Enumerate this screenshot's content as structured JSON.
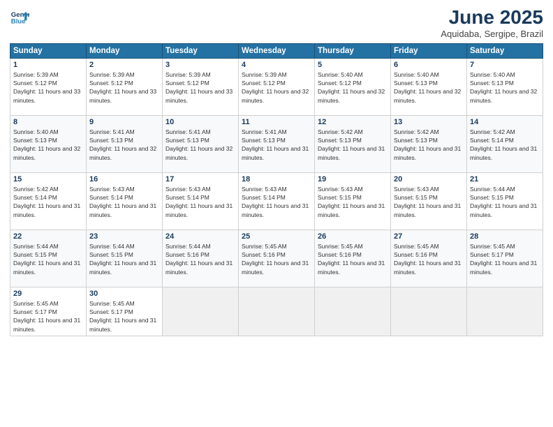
{
  "header": {
    "logo_line1": "General",
    "logo_line2": "Blue",
    "month": "June 2025",
    "location": "Aquidaba, Sergipe, Brazil"
  },
  "weekdays": [
    "Sunday",
    "Monday",
    "Tuesday",
    "Wednesday",
    "Thursday",
    "Friday",
    "Saturday"
  ],
  "weeks": [
    [
      {
        "day": "1",
        "sunrise": "5:39 AM",
        "sunset": "5:12 PM",
        "daylight": "11 hours and 33 minutes."
      },
      {
        "day": "2",
        "sunrise": "5:39 AM",
        "sunset": "5:12 PM",
        "daylight": "11 hours and 33 minutes."
      },
      {
        "day": "3",
        "sunrise": "5:39 AM",
        "sunset": "5:12 PM",
        "daylight": "11 hours and 33 minutes."
      },
      {
        "day": "4",
        "sunrise": "5:39 AM",
        "sunset": "5:12 PM",
        "daylight": "11 hours and 32 minutes."
      },
      {
        "day": "5",
        "sunrise": "5:40 AM",
        "sunset": "5:12 PM",
        "daylight": "11 hours and 32 minutes."
      },
      {
        "day": "6",
        "sunrise": "5:40 AM",
        "sunset": "5:13 PM",
        "daylight": "11 hours and 32 minutes."
      },
      {
        "day": "7",
        "sunrise": "5:40 AM",
        "sunset": "5:13 PM",
        "daylight": "11 hours and 32 minutes."
      }
    ],
    [
      {
        "day": "8",
        "sunrise": "5:40 AM",
        "sunset": "5:13 PM",
        "daylight": "11 hours and 32 minutes."
      },
      {
        "day": "9",
        "sunrise": "5:41 AM",
        "sunset": "5:13 PM",
        "daylight": "11 hours and 32 minutes."
      },
      {
        "day": "10",
        "sunrise": "5:41 AM",
        "sunset": "5:13 PM",
        "daylight": "11 hours and 32 minutes."
      },
      {
        "day": "11",
        "sunrise": "5:41 AM",
        "sunset": "5:13 PM",
        "daylight": "11 hours and 31 minutes."
      },
      {
        "day": "12",
        "sunrise": "5:42 AM",
        "sunset": "5:13 PM",
        "daylight": "11 hours and 31 minutes."
      },
      {
        "day": "13",
        "sunrise": "5:42 AM",
        "sunset": "5:13 PM",
        "daylight": "11 hours and 31 minutes."
      },
      {
        "day": "14",
        "sunrise": "5:42 AM",
        "sunset": "5:14 PM",
        "daylight": "11 hours and 31 minutes."
      }
    ],
    [
      {
        "day": "15",
        "sunrise": "5:42 AM",
        "sunset": "5:14 PM",
        "daylight": "11 hours and 31 minutes."
      },
      {
        "day": "16",
        "sunrise": "5:43 AM",
        "sunset": "5:14 PM",
        "daylight": "11 hours and 31 minutes."
      },
      {
        "day": "17",
        "sunrise": "5:43 AM",
        "sunset": "5:14 PM",
        "daylight": "11 hours and 31 minutes."
      },
      {
        "day": "18",
        "sunrise": "5:43 AM",
        "sunset": "5:14 PM",
        "daylight": "11 hours and 31 minutes."
      },
      {
        "day": "19",
        "sunrise": "5:43 AM",
        "sunset": "5:15 PM",
        "daylight": "11 hours and 31 minutes."
      },
      {
        "day": "20",
        "sunrise": "5:43 AM",
        "sunset": "5:15 PM",
        "daylight": "11 hours and 31 minutes."
      },
      {
        "day": "21",
        "sunrise": "5:44 AM",
        "sunset": "5:15 PM",
        "daylight": "11 hours and 31 minutes."
      }
    ],
    [
      {
        "day": "22",
        "sunrise": "5:44 AM",
        "sunset": "5:15 PM",
        "daylight": "11 hours and 31 minutes."
      },
      {
        "day": "23",
        "sunrise": "5:44 AM",
        "sunset": "5:15 PM",
        "daylight": "11 hours and 31 minutes."
      },
      {
        "day": "24",
        "sunrise": "5:44 AM",
        "sunset": "5:16 PM",
        "daylight": "11 hours and 31 minutes."
      },
      {
        "day": "25",
        "sunrise": "5:45 AM",
        "sunset": "5:16 PM",
        "daylight": "11 hours and 31 minutes."
      },
      {
        "day": "26",
        "sunrise": "5:45 AM",
        "sunset": "5:16 PM",
        "daylight": "11 hours and 31 minutes."
      },
      {
        "day": "27",
        "sunrise": "5:45 AM",
        "sunset": "5:16 PM",
        "daylight": "11 hours and 31 minutes."
      },
      {
        "day": "28",
        "sunrise": "5:45 AM",
        "sunset": "5:17 PM",
        "daylight": "11 hours and 31 minutes."
      }
    ],
    [
      {
        "day": "29",
        "sunrise": "5:45 AM",
        "sunset": "5:17 PM",
        "daylight": "11 hours and 31 minutes."
      },
      {
        "day": "30",
        "sunrise": "5:45 AM",
        "sunset": "5:17 PM",
        "daylight": "11 hours and 31 minutes."
      },
      null,
      null,
      null,
      null,
      null
    ]
  ]
}
